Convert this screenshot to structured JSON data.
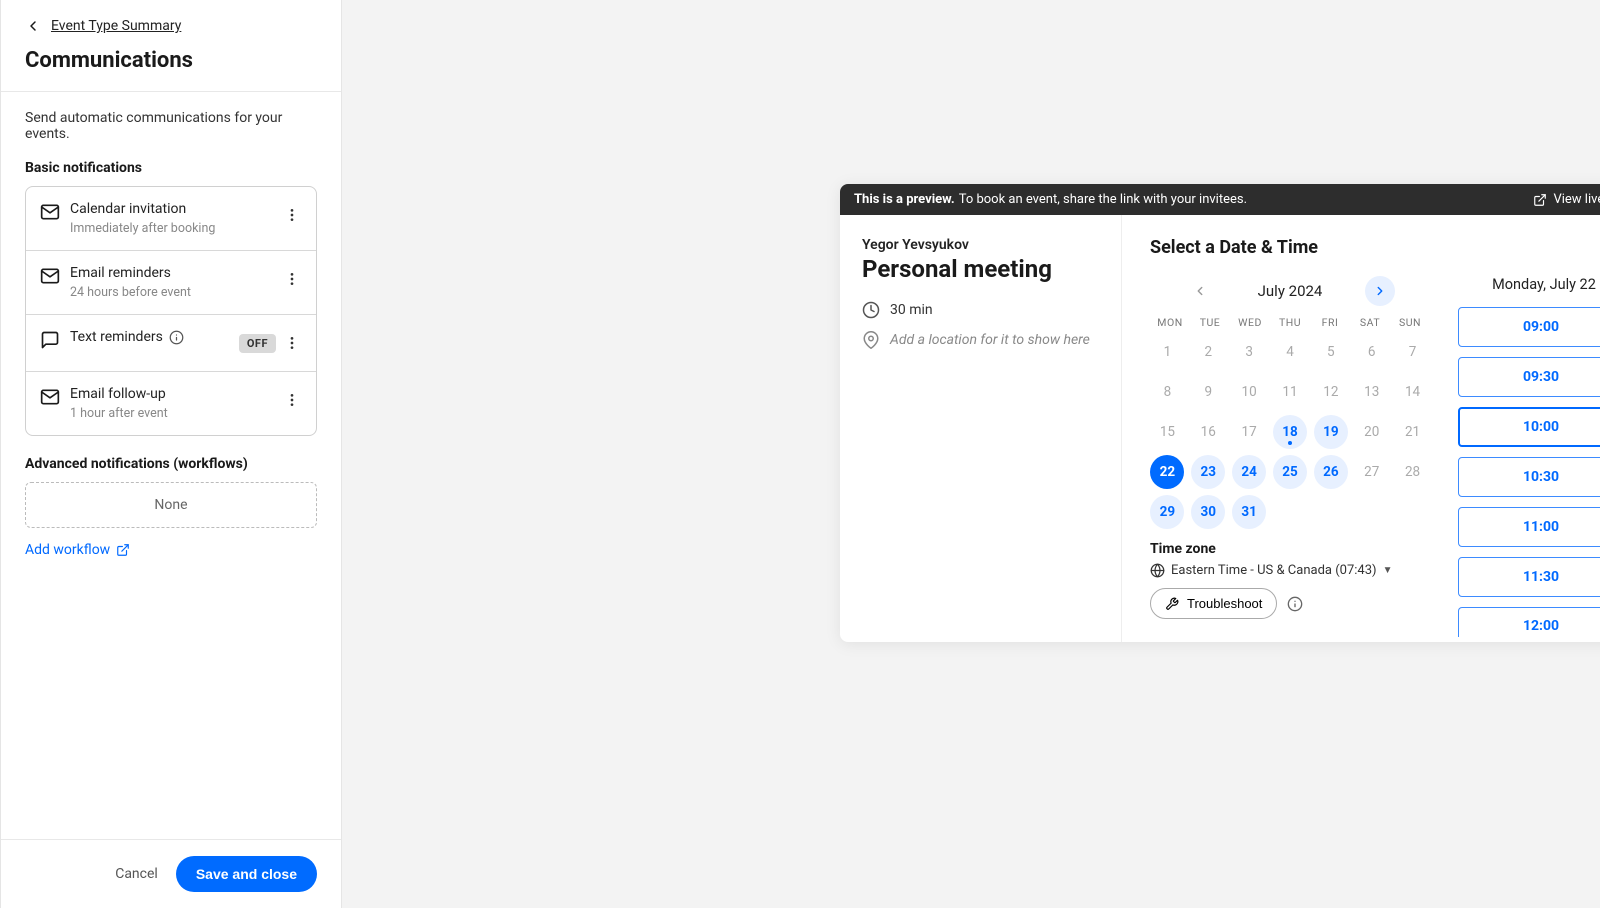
{
  "sidebar": {
    "back_label": "Event Type Summary",
    "page_title": "Communications",
    "intro": "Send automatic communications for your events.",
    "basic_heading": "Basic notifications",
    "items": [
      {
        "icon": "mail-icon",
        "title": "Calendar invitation",
        "sub": "Immediately after booking",
        "off": false
      },
      {
        "icon": "mail-icon",
        "title": "Email reminders",
        "sub": "24 hours before event",
        "off": false
      },
      {
        "icon": "chat-icon",
        "title": "Text reminders",
        "sub": "",
        "off": true,
        "info": true
      },
      {
        "icon": "mail-icon",
        "title": "Email follow-up",
        "sub": "1 hour after event",
        "off": false
      }
    ],
    "off_badge": "OFF",
    "adv_heading": "Advanced notifications (workflows)",
    "workflows_empty": "None",
    "add_workflow_label": "Add workflow",
    "cancel": "Cancel",
    "save": "Save and close"
  },
  "preview": {
    "bar_strong": "This is a preview.",
    "bar_rest": "To book an event, share the link with your invitees.",
    "view_live": "View live page",
    "host": "Yegor Yevsyukov",
    "event_title": "Personal meeting",
    "duration": "30 min",
    "location_placeholder": "Add a location for it to show here",
    "select_heading": "Select a Date & Time",
    "month_label": "July 2024",
    "dow": [
      "MON",
      "TUE",
      "WED",
      "THU",
      "FRI",
      "SAT",
      "SUN"
    ],
    "days": [
      {
        "n": "1"
      },
      {
        "n": "2"
      },
      {
        "n": "3"
      },
      {
        "n": "4"
      },
      {
        "n": "5"
      },
      {
        "n": "6"
      },
      {
        "n": "7"
      },
      {
        "n": "8"
      },
      {
        "n": "9"
      },
      {
        "n": "10"
      },
      {
        "n": "11"
      },
      {
        "n": "12"
      },
      {
        "n": "13"
      },
      {
        "n": "14"
      },
      {
        "n": "15"
      },
      {
        "n": "16"
      },
      {
        "n": "17"
      },
      {
        "n": "18",
        "cls": "available day-dot"
      },
      {
        "n": "19",
        "cls": "available"
      },
      {
        "n": "20"
      },
      {
        "n": "21"
      },
      {
        "n": "22",
        "cls": "selected"
      },
      {
        "n": "23",
        "cls": "available"
      },
      {
        "n": "24",
        "cls": "available"
      },
      {
        "n": "25",
        "cls": "available"
      },
      {
        "n": "26",
        "cls": "available"
      },
      {
        "n": "27"
      },
      {
        "n": "28"
      },
      {
        "n": "29",
        "cls": "available"
      },
      {
        "n": "30",
        "cls": "available"
      },
      {
        "n": "31",
        "cls": "available"
      }
    ],
    "selected_date_label": "Monday, July 22",
    "time_slots": [
      "09:00",
      "09:30",
      "10:00",
      "10:30",
      "11:00",
      "11:30",
      "12:00"
    ],
    "selected_time_index": 2,
    "tz_heading": "Time zone",
    "tz_value": "Eastern Time - US & Canada (07:43)",
    "troubleshoot": "Troubleshoot"
  }
}
